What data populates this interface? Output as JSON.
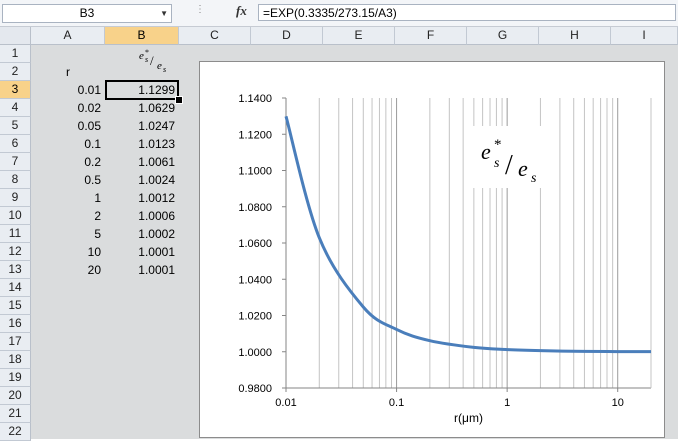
{
  "formula_bar": {
    "name_box": "B3",
    "fx_label": "fx",
    "formula": "=EXP(0.3335/273.15/A3)"
  },
  "columns": [
    "A",
    "B",
    "C",
    "D",
    "E",
    "F",
    "G",
    "H",
    "I"
  ],
  "rows": [
    "1",
    "2",
    "3",
    "4",
    "5",
    "6",
    "7",
    "8",
    "9",
    "10",
    "11",
    "12",
    "13",
    "14",
    "15",
    "16",
    "17",
    "18",
    "19",
    "20",
    "21",
    "22"
  ],
  "selected_cell": "B3",
  "cells": {
    "a2": "r",
    "b2": "es*/es",
    "col_a": [
      "0.01",
      "0.02",
      "0.05",
      "0.1",
      "0.2",
      "0.5",
      "1",
      "2",
      "5",
      "10",
      "20"
    ],
    "col_b": [
      "1.1299",
      "1.0629",
      "1.0247",
      "1.0123",
      "1.0061",
      "1.0024",
      "1.0012",
      "1.0006",
      "1.0002",
      "1.0001",
      "1.0001"
    ]
  },
  "chart_data": {
    "type": "line",
    "title": "es*/es",
    "xlabel": "r(μm)",
    "ylabel": "",
    "x_scale": "log",
    "xlim": [
      0.01,
      20
    ],
    "ylim": [
      0.98,
      1.14
    ],
    "x_ticks": [
      "0.01",
      "0.1",
      "1",
      "10"
    ],
    "y_ticks": [
      "0.9800",
      "1.0000",
      "1.0200",
      "1.0400",
      "1.0600",
      "1.0800",
      "1.1000",
      "1.1200",
      "1.1400"
    ],
    "grid": "vertical minor log gridlines",
    "series": [
      {
        "color": "#4a7ebb",
        "x": [
          0.01,
          0.02,
          0.05,
          0.1,
          0.2,
          0.5,
          1,
          2,
          5,
          10,
          20
        ],
        "values": [
          1.1299,
          1.0629,
          1.0247,
          1.0123,
          1.0061,
          1.0024,
          1.0012,
          1.0006,
          1.0002,
          1.0001,
          1.0001
        ]
      }
    ]
  }
}
